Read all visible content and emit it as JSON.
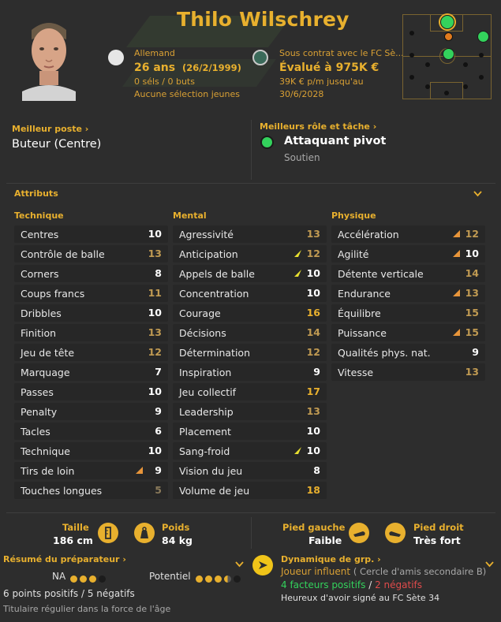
{
  "player": {
    "name": "Thilo Wilschrey",
    "nationality": "Allemand",
    "age": "26 ans",
    "birthdate": "(26/2/1999)",
    "caps": "0 séls / 0 buts",
    "youth": "Aucune sélection jeunes",
    "contract": "Sous contrat avec le FC Sè...",
    "value": "Évalué à 975K €",
    "wage": "39K € p/m jusqu'au",
    "contract_end": "30/6/2028"
  },
  "best_position": {
    "label": "Meilleur poste",
    "value": "Buteur (Centre)"
  },
  "best_role": {
    "label": "Meilleurs rôle et tâche",
    "role": "Attaquant pivot",
    "duty": "Soutien"
  },
  "attributes_title": "Attributs",
  "colors": {
    "gold": "#e8b02e",
    "muted": "#c09a52",
    "green": "#33d25c",
    "orange": "#e07a1e",
    "red": "#e04b4b"
  },
  "technical": {
    "title": "Technique",
    "rows": [
      {
        "name": "Centres",
        "value": "10",
        "level": "high",
        "arrow": ""
      },
      {
        "name": "Contrôle de balle",
        "value": "13",
        "level": "mid",
        "arrow": ""
      },
      {
        "name": "Corners",
        "value": "8",
        "level": "high",
        "arrow": ""
      },
      {
        "name": "Coups francs",
        "value": "11",
        "level": "mid",
        "arrow": ""
      },
      {
        "name": "Dribbles",
        "value": "10",
        "level": "high",
        "arrow": ""
      },
      {
        "name": "Finition",
        "value": "13",
        "level": "mid",
        "arrow": ""
      },
      {
        "name": "Jeu de tête",
        "value": "12",
        "level": "mid",
        "arrow": ""
      },
      {
        "name": "Marquage",
        "value": "7",
        "level": "high",
        "arrow": ""
      },
      {
        "name": "Passes",
        "value": "10",
        "level": "high",
        "arrow": ""
      },
      {
        "name": "Penalty",
        "value": "9",
        "level": "high",
        "arrow": ""
      },
      {
        "name": "Tacles",
        "value": "6",
        "level": "high",
        "arrow": ""
      },
      {
        "name": "Technique",
        "value": "10",
        "level": "high",
        "arrow": ""
      },
      {
        "name": "Tirs de loin",
        "value": "9",
        "level": "high",
        "arrow": "up"
      },
      {
        "name": "Touches longues",
        "value": "5",
        "level": "low",
        "arrow": ""
      }
    ]
  },
  "mental": {
    "title": "Mental",
    "rows": [
      {
        "name": "Agressivité",
        "value": "13",
        "level": "mid",
        "arrow": ""
      },
      {
        "name": "Anticipation",
        "value": "12",
        "level": "mid",
        "arrow": "yellow"
      },
      {
        "name": "Appels de balle",
        "value": "10",
        "level": "high",
        "arrow": "yellow"
      },
      {
        "name": "Concentration",
        "value": "10",
        "level": "high",
        "arrow": ""
      },
      {
        "name": "Courage",
        "value": "16",
        "level": "gold",
        "arrow": ""
      },
      {
        "name": "Décisions",
        "value": "14",
        "level": "mid",
        "arrow": ""
      },
      {
        "name": "Détermination",
        "value": "12",
        "level": "mid",
        "arrow": ""
      },
      {
        "name": "Inspiration",
        "value": "9",
        "level": "high",
        "arrow": ""
      },
      {
        "name": "Jeu collectif",
        "value": "17",
        "level": "gold",
        "arrow": ""
      },
      {
        "name": "Leadership",
        "value": "13",
        "level": "mid",
        "arrow": ""
      },
      {
        "name": "Placement",
        "value": "10",
        "level": "high",
        "arrow": ""
      },
      {
        "name": "Sang-froid",
        "value": "10",
        "level": "high",
        "arrow": "yellow"
      },
      {
        "name": "Vision du jeu",
        "value": "8",
        "level": "high",
        "arrow": ""
      },
      {
        "name": "Volume de jeu",
        "value": "18",
        "level": "gold",
        "arrow": ""
      }
    ]
  },
  "physical": {
    "title": "Physique",
    "rows": [
      {
        "name": "Accélération",
        "value": "12",
        "level": "mid",
        "arrow": "up"
      },
      {
        "name": "Agilité",
        "value": "10",
        "level": "high",
        "arrow": "up"
      },
      {
        "name": "Détente verticale",
        "value": "14",
        "level": "mid",
        "arrow": ""
      },
      {
        "name": "Endurance",
        "value": "13",
        "level": "mid",
        "arrow": "up"
      },
      {
        "name": "Équilibre",
        "value": "15",
        "level": "mid",
        "arrow": ""
      },
      {
        "name": "Puissance",
        "value": "15",
        "level": "mid",
        "arrow": "up"
      },
      {
        "name": "Qualités phys. nat.",
        "value": "9",
        "level": "high",
        "arrow": ""
      },
      {
        "name": "Vitesse",
        "value": "13",
        "level": "mid",
        "arrow": ""
      }
    ]
  },
  "bottom": {
    "height_label": "Taille",
    "height_value": "186 cm",
    "weight_label": "Poids",
    "weight_value": "84 kg",
    "left_foot_label": "Pied gauche",
    "left_foot_value": "Faible",
    "right_foot_label": "Pied droit",
    "right_foot_value": "Très fort",
    "coach_label": "Résumé du préparateur",
    "na_label": "NA",
    "na_stars": 3,
    "potential_label": "Potentiel",
    "potential_stars": 3.5,
    "points": "6 points positifs / 5 négatifs",
    "coach_note": "Titulaire régulier dans la force de l'âge",
    "dynamics_label": "Dynamique de grp.",
    "influence": "Joueur influent",
    "circle": "( Cercle d'amis secondaire B)",
    "positives": "4 facteurs positifs",
    "slash": "/",
    "negatives": "2 négatifs",
    "signed": "Heureux d'avoir signé au FC Sète 34"
  }
}
